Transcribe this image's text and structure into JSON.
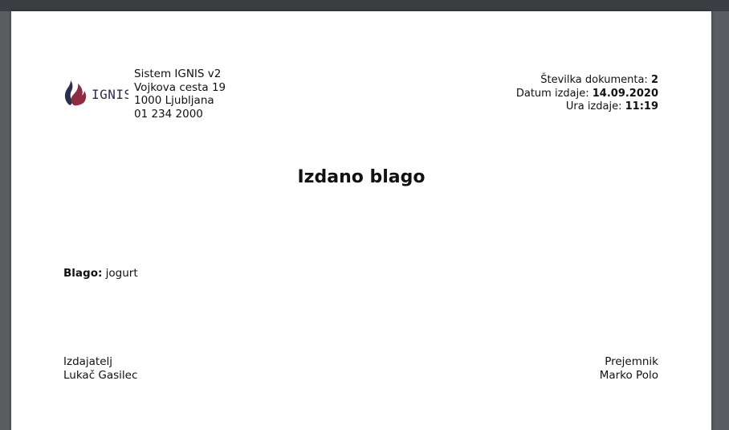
{
  "header": {
    "logo_text": "IGNIS",
    "company": {
      "name": "Sistem IGNIS v2",
      "street": "Vojkova cesta 19",
      "city": "1000 Ljubljana",
      "phone": "01 234 2000"
    },
    "document": {
      "number_label": "Številka dokumenta:",
      "number_value": "2",
      "date_label": "Datum izdaje:",
      "date_value": "14.09.2020",
      "time_label": "Ura izdaje:",
      "time_value": "11:19"
    }
  },
  "title": "Izdano blago",
  "item": {
    "label": "Blago:",
    "value": "jogurt"
  },
  "signatures": {
    "issuer_label": "Izdajatelj",
    "issuer_name": "Lukač Gasilec",
    "receiver_label": "Prejemnik",
    "receiver_name": "Marko Polo"
  },
  "colors": {
    "logo_flame_dark": "#2a2f4f",
    "logo_flame_red": "#8e2d3f",
    "logo_text": "#2b2f4d"
  }
}
